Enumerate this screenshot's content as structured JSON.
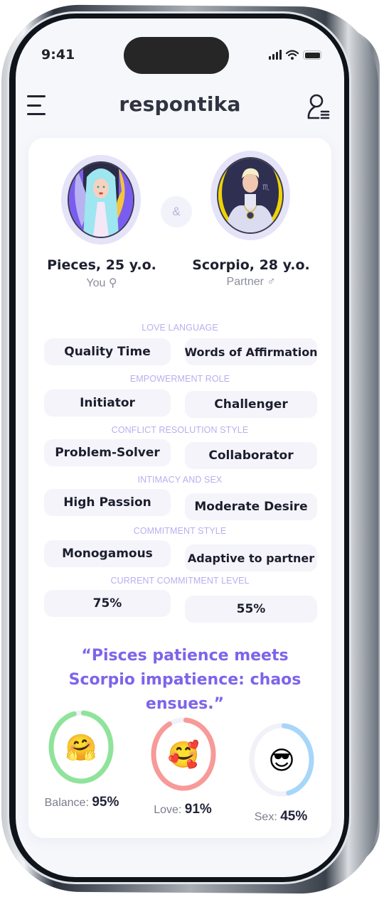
{
  "status_bar": {
    "time": "9:41"
  },
  "header": {
    "app_title": "respontika",
    "menu_icon": "hamburger-menu-icon",
    "profile_icon": "user-list-icon"
  },
  "profiles": {
    "you": {
      "name": "Pieces, 25 y.o.",
      "role": "You ⚲",
      "sign": "Pisces"
    },
    "partner": {
      "name": "Scorpio, 28 y.o.",
      "role": "Partner ♂",
      "sign": "Scorpio"
    },
    "connector": "&"
  },
  "traits": [
    {
      "label": "LOVE LANGUAGE",
      "you": "Quality Time",
      "partner": "Words of Affirmation"
    },
    {
      "label": "EMPOWERMENT ROLE",
      "you": "Initiator",
      "partner": "Challenger"
    },
    {
      "label": "CONFLICT RESOLUTION STYLE",
      "you": "Problem-Solver",
      "partner": "Collaborator"
    },
    {
      "label": "INTIMACY AND SEX",
      "you": "High Passion",
      "partner": "Moderate Desire"
    },
    {
      "label": "COMMITMENT STYLE",
      "you": "Monogamous",
      "partner": "Adaptive to partner"
    },
    {
      "label": "CURRENT COMMITMENT LEVEL",
      "you": "75%",
      "partner": "55%"
    }
  ],
  "quote": "“Pisces patience meets Scorpio impatience: chaos ensues.”",
  "scores": [
    {
      "name": "Balance",
      "label": "Balance:",
      "value_text": "95%",
      "value": 0.95,
      "color": "#8fe39a",
      "emoji": "🤗"
    },
    {
      "name": "Love",
      "label": "Love:",
      "value_text": "91%",
      "value": 0.91,
      "color": "#f79a98",
      "emoji": "🥰"
    },
    {
      "name": "Sex",
      "label": "Sex:",
      "value_text": "45%",
      "value": 0.45,
      "color": "#a7d6fb",
      "emoji": "😎"
    }
  ],
  "colors": {
    "accent": "#7e64ea",
    "section_label": "#b9aef0",
    "track": "#f1f2f8"
  }
}
